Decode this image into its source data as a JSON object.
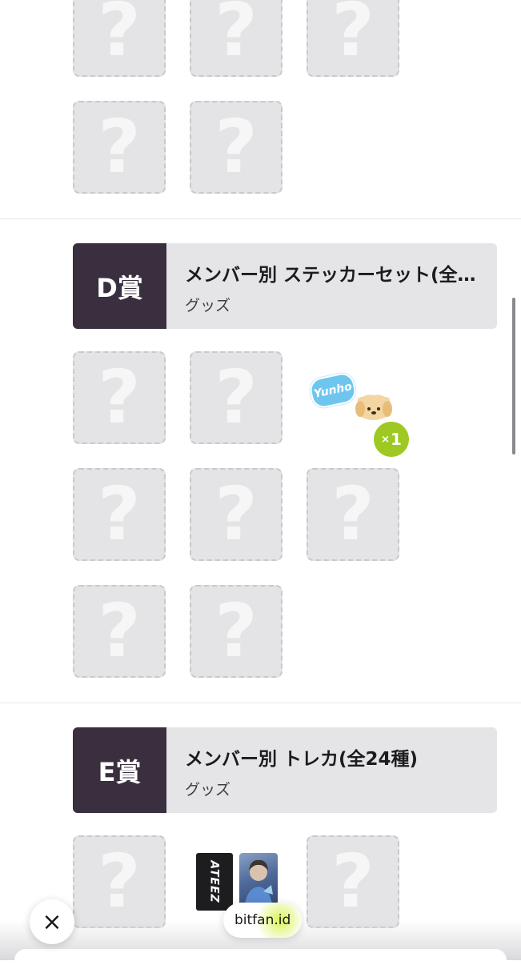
{
  "mystery_symbol": "?",
  "prizes": [
    {
      "rank": "D賞",
      "title": "メンバー別 ステッカーセット(全…",
      "category": "グッズ",
      "revealed_item": {
        "sticker_text": "Yunho",
        "count_prefix": "×",
        "count": "1"
      }
    },
    {
      "rank": "E賞",
      "title": "メンバー別 トレカ(全24種)",
      "category": "グッズ",
      "revealed_item": {
        "card_text": "ATEEZ"
      }
    }
  ],
  "overlay": {
    "close_icon": "×",
    "brand": "bitfan.id"
  },
  "colors": {
    "rank_bg": "#3a2f3e",
    "tile_bg": "#e4e4e6",
    "badge": "#9dc922"
  }
}
